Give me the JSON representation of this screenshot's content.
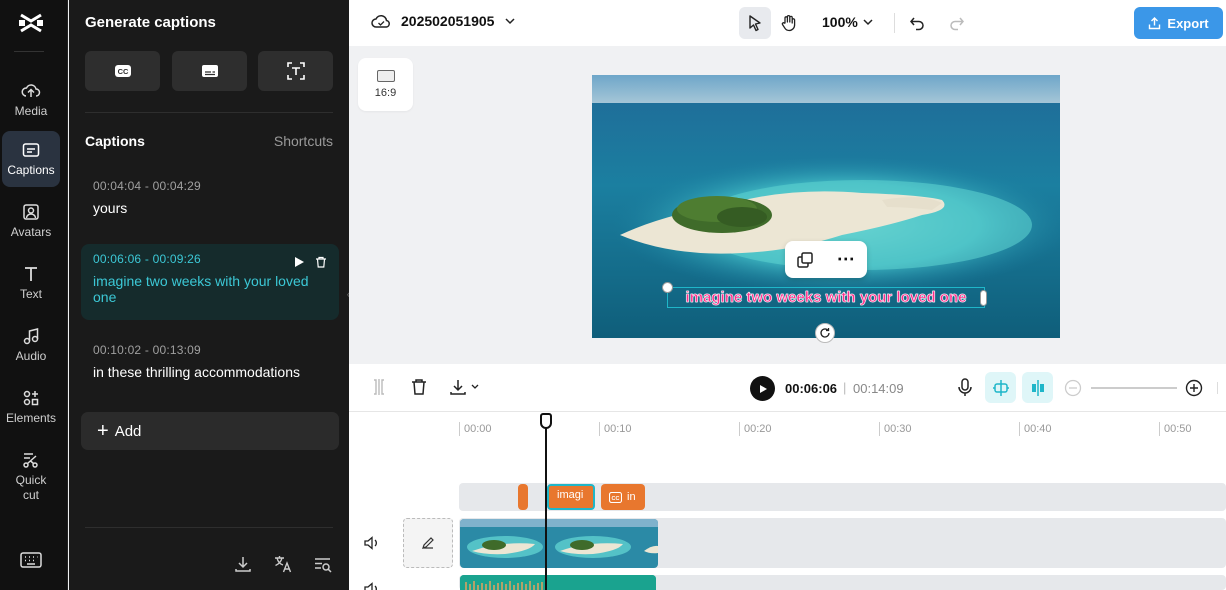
{
  "rail": {
    "items": [
      {
        "label": "Media",
        "icon": "cloud-upload-icon"
      },
      {
        "label": "Captions",
        "icon": "captions-icon",
        "active": true
      },
      {
        "label": "Avatars",
        "icon": "avatar-icon"
      },
      {
        "label": "Text",
        "icon": "text-icon"
      },
      {
        "label": "Audio",
        "icon": "music-note-icon"
      },
      {
        "label": "Elements",
        "icon": "elements-icon"
      },
      {
        "label": "Quick cut",
        "icon": "quick-cut-icon"
      }
    ]
  },
  "panel": {
    "title": "Generate captions",
    "section_title": "Captions",
    "shortcuts_label": "Shortcuts",
    "captions": [
      {
        "time": "00:04:04 - 00:04:29",
        "text": "yours"
      },
      {
        "time": "00:06:06 - 00:09:26",
        "text": "imagine two weeks with your loved one"
      },
      {
        "time": "00:10:02 - 00:13:09",
        "text": "in these thrilling accommodations"
      }
    ],
    "add_label": "Add"
  },
  "topbar": {
    "project_name": "202502051905",
    "zoom": "100%",
    "export_label": "Export"
  },
  "preview": {
    "aspect_ratio": "16:9",
    "caption_text": "imagine two weeks with your loved one"
  },
  "playback": {
    "current_time": "00:06:06",
    "separator": "|",
    "total_time": "00:14:09"
  },
  "timeline": {
    "ruler": [
      "00:00",
      "00:10",
      "00:20",
      "00:30",
      "00:40",
      "00:50"
    ],
    "caption_clip_text": "imagi",
    "cc_clip_text": "in"
  },
  "colors": {
    "accent": "#3cc8d6",
    "export": "#3b97e8",
    "caption_pink": "#ff2d8b",
    "clip_orange": "#e8772e"
  }
}
